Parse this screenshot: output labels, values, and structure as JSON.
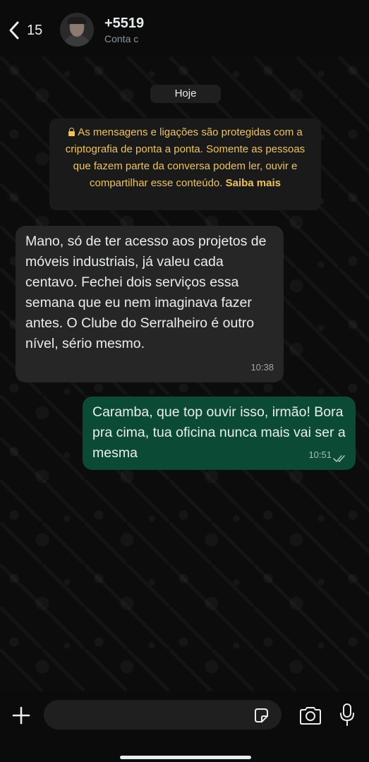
{
  "header": {
    "back_count": "15",
    "contact_name": "+5519",
    "contact_sub": "Conta c"
  },
  "chat": {
    "date_chip": "Hoje",
    "notice": {
      "text": "As mensagens e ligações são protegidas com a criptografia de ponta a ponta. Somente as pessoas que fazem parte da conversa podem ler, ouvir e compartilhar esse conteúdo.",
      "learn_more": "Saiba mais"
    },
    "messages": [
      {
        "direction": "incoming",
        "text": "Mano, só de ter acesso aos projetos de móveis industriais, já valeu cada centavo. Fechei dois serviços essa semana que eu nem imaginava fazer antes. O Clube do Serralheiro é outro nível, sério mesmo.",
        "time": "10:38"
      },
      {
        "direction": "outgoing",
        "text": "Caramba, que top ouvir isso, irmão! Bora pra cima, tua oficina nunca mais vai ser a mesma",
        "time": "10:51",
        "status": "read"
      }
    ]
  },
  "composer": {
    "placeholder": ""
  },
  "icons": {
    "back": "chevron-left-icon",
    "lock": "lock-icon",
    "attach": "plus-icon",
    "sticker": "sticker-icon",
    "camera": "camera-icon",
    "mic": "microphone-icon",
    "read_receipt": "double-check-icon"
  },
  "colors": {
    "background": "#0b0b0b",
    "incoming_bubble": "#262626",
    "outgoing_bubble": "#0b4a35",
    "notice_text": "#f0c35a"
  }
}
